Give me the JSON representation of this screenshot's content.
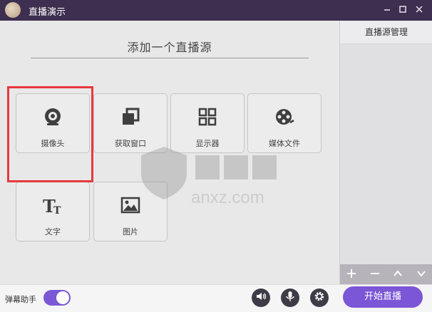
{
  "window": {
    "title": "直播演示",
    "controls": [
      "minimize-icon",
      "maximize-icon",
      "close-icon"
    ]
  },
  "main": {
    "section_title": "添加一个直播源",
    "sources": [
      {
        "label": "摄像头",
        "icon": "camera-icon",
        "selected": true
      },
      {
        "label": "获取窗口",
        "icon": "window-capture-icon"
      },
      {
        "label": "显示器",
        "icon": "display-grid-icon"
      },
      {
        "label": "媒体文件",
        "icon": "media-file-icon"
      },
      {
        "label": "文字",
        "icon": "text-icon"
      },
      {
        "label": "图片",
        "icon": "image-icon"
      }
    ],
    "highlight_color": "#e6393d"
  },
  "side_panel": {
    "title": "直播源管理",
    "toolbar": [
      "add-icon",
      "remove-icon",
      "move-up-icon",
      "move-down-icon"
    ]
  },
  "bottom": {
    "danmaku_label": "弹幕助手",
    "danmaku_enabled": true,
    "start_label": "开始直播",
    "accent_color": "#7b56d6"
  },
  "watermark": {
    "text": "anxz.com"
  }
}
